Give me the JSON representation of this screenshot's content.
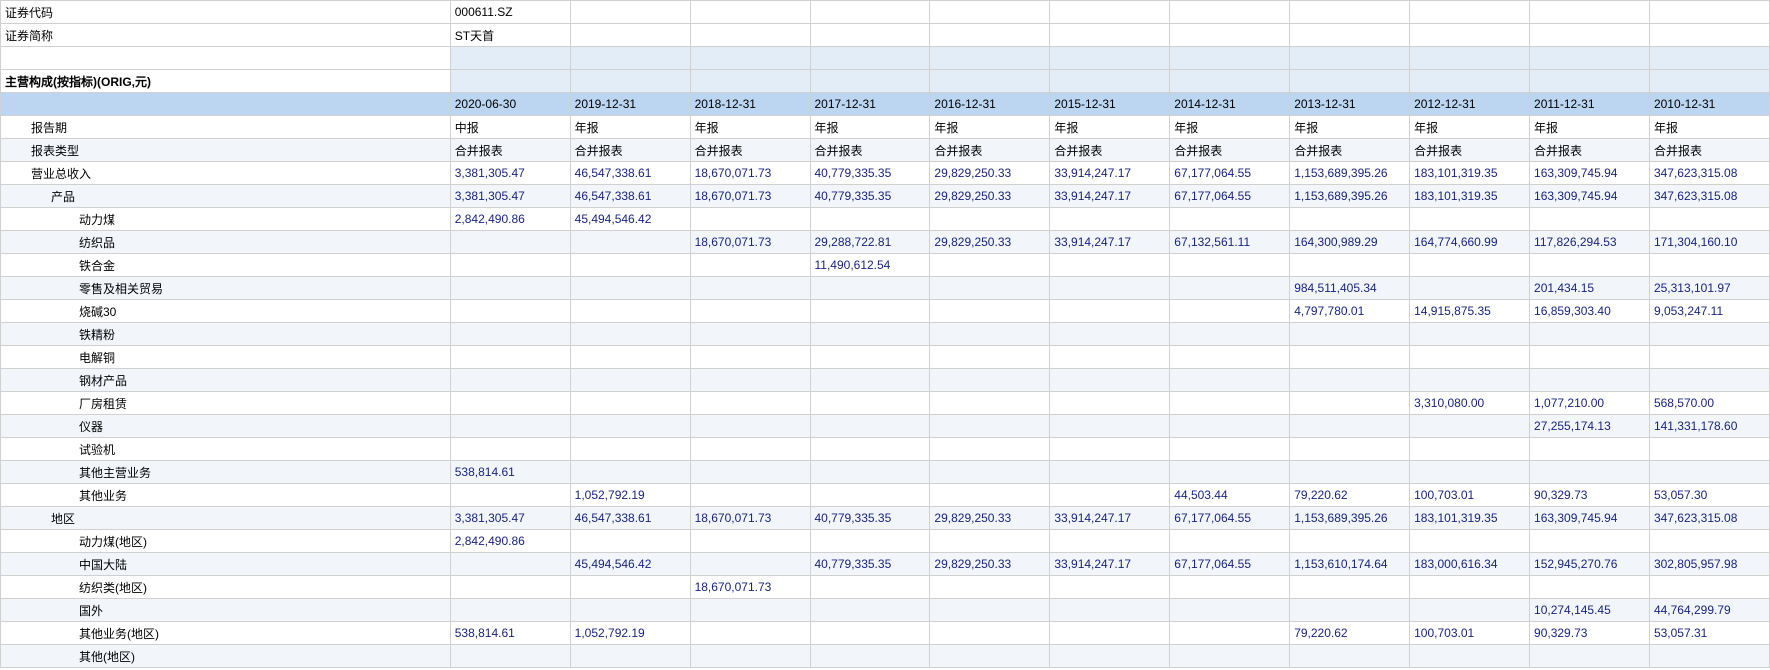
{
  "header": {
    "code_lbl": "证券代码",
    "code_val": "000611.SZ",
    "name_lbl": "证券简称",
    "name_val": "ST天首"
  },
  "section_title": "主营构成(按指标)(ORIG,元)",
  "dates": [
    "2020-06-30",
    "2019-12-31",
    "2018-12-31",
    "2017-12-31",
    "2016-12-31",
    "2015-12-31",
    "2014-12-31",
    "2013-12-31",
    "2012-12-31",
    "2011-12-31",
    "2010-12-31"
  ],
  "rows": [
    {
      "lbl": "报告期",
      "ind": 1,
      "cls": "empty",
      "vals": [
        "中报",
        "年报",
        "年报",
        "年报",
        "年报",
        "年报",
        "年报",
        "年报",
        "年报",
        "年报",
        "年报"
      ],
      "num": false
    },
    {
      "lbl": "报表类型",
      "ind": 1,
      "cls": "alt",
      "vals": [
        "合并报表",
        "合并报表",
        "合并报表",
        "合并报表",
        "合并报表",
        "合并报表",
        "合并报表",
        "合并报表",
        "合并报表",
        "合并报表",
        "合并报表"
      ],
      "num": false
    },
    {
      "lbl": "营业总收入",
      "ind": 1,
      "cls": "empty",
      "vals": [
        "3,381,305.47",
        "46,547,338.61",
        "18,670,071.73",
        "40,779,335.35",
        "29,829,250.33",
        "33,914,247.17",
        "67,177,064.55",
        "1,153,689,395.26",
        "183,101,319.35",
        "163,309,745.94",
        "347,623,315.08"
      ],
      "num": true
    },
    {
      "lbl": "产品",
      "ind": 2,
      "cls": "alt",
      "vals": [
        "3,381,305.47",
        "46,547,338.61",
        "18,670,071.73",
        "40,779,335.35",
        "29,829,250.33",
        "33,914,247.17",
        "67,177,064.55",
        "1,153,689,395.26",
        "183,101,319.35",
        "163,309,745.94",
        "347,623,315.08"
      ],
      "num": true
    },
    {
      "lbl": "动力煤",
      "ind": 3,
      "cls": "empty",
      "vals": [
        "2,842,490.86",
        "45,494,546.42",
        "",
        "",
        "",
        "",
        "",
        "",
        "",
        "",
        ""
      ],
      "num": true
    },
    {
      "lbl": "纺织品",
      "ind": 3,
      "cls": "alt",
      "vals": [
        "",
        "",
        "18,670,071.73",
        "29,288,722.81",
        "29,829,250.33",
        "33,914,247.17",
        "67,132,561.11",
        "164,300,989.29",
        "164,774,660.99",
        "117,826,294.53",
        "171,304,160.10"
      ],
      "num": true
    },
    {
      "lbl": "铁合金",
      "ind": 3,
      "cls": "empty",
      "vals": [
        "",
        "",
        "",
        "11,490,612.54",
        "",
        "",
        "",
        "",
        "",
        "",
        ""
      ],
      "num": true
    },
    {
      "lbl": "零售及相关贸易",
      "ind": 3,
      "cls": "alt",
      "vals": [
        "",
        "",
        "",
        "",
        "",
        "",
        "",
        "984,511,405.34",
        "",
        "201,434.15",
        "25,313,101.97"
      ],
      "num": true
    },
    {
      "lbl": "烧碱30",
      "ind": 3,
      "cls": "empty",
      "vals": [
        "",
        "",
        "",
        "",
        "",
        "",
        "",
        "4,797,780.01",
        "14,915,875.35",
        "16,859,303.40",
        "9,053,247.11"
      ],
      "num": true
    },
    {
      "lbl": "铁精粉",
      "ind": 3,
      "cls": "alt",
      "vals": [
        "",
        "",
        "",
        "",
        "",
        "",
        "",
        "",
        "",
        "",
        ""
      ],
      "num": true
    },
    {
      "lbl": "电解铜",
      "ind": 3,
      "cls": "empty",
      "vals": [
        "",
        "",
        "",
        "",
        "",
        "",
        "",
        "",
        "",
        "",
        ""
      ],
      "num": true
    },
    {
      "lbl": "钢材产品",
      "ind": 3,
      "cls": "alt",
      "vals": [
        "",
        "",
        "",
        "",
        "",
        "",
        "",
        "",
        "",
        "",
        ""
      ],
      "num": true
    },
    {
      "lbl": "厂房租赁",
      "ind": 3,
      "cls": "empty",
      "vals": [
        "",
        "",
        "",
        "",
        "",
        "",
        "",
        "",
        "3,310,080.00",
        "1,077,210.00",
        "568,570.00"
      ],
      "num": true
    },
    {
      "lbl": "仪器",
      "ind": 3,
      "cls": "alt",
      "vals": [
        "",
        "",
        "",
        "",
        "",
        "",
        "",
        "",
        "",
        "27,255,174.13",
        "141,331,178.60"
      ],
      "num": true
    },
    {
      "lbl": "试验机",
      "ind": 3,
      "cls": "empty",
      "vals": [
        "",
        "",
        "",
        "",
        "",
        "",
        "",
        "",
        "",
        "",
        ""
      ],
      "num": true
    },
    {
      "lbl": "其他主营业务",
      "ind": 3,
      "cls": "alt",
      "vals": [
        "538,814.61",
        "",
        "",
        "",
        "",
        "",
        "",
        "",
        "",
        "",
        ""
      ],
      "num": true
    },
    {
      "lbl": "其他业务",
      "ind": 3,
      "cls": "empty",
      "vals": [
        "",
        "1,052,792.19",
        "",
        "",
        "",
        "",
        "44,503.44",
        "79,220.62",
        "100,703.01",
        "90,329.73",
        "53,057.30"
      ],
      "num": true
    },
    {
      "lbl": "地区",
      "ind": 2,
      "cls": "alt",
      "vals": [
        "3,381,305.47",
        "46,547,338.61",
        "18,670,071.73",
        "40,779,335.35",
        "29,829,250.33",
        "33,914,247.17",
        "67,177,064.55",
        "1,153,689,395.26",
        "183,101,319.35",
        "163,309,745.94",
        "347,623,315.08"
      ],
      "num": true
    },
    {
      "lbl": "动力煤(地区)",
      "ind": 3,
      "cls": "empty",
      "vals": [
        "2,842,490.86",
        "",
        "",
        "",
        "",
        "",
        "",
        "",
        "",
        "",
        ""
      ],
      "num": true
    },
    {
      "lbl": "中国大陆",
      "ind": 3,
      "cls": "alt",
      "vals": [
        "",
        "45,494,546.42",
        "",
        "40,779,335.35",
        "29,829,250.33",
        "33,914,247.17",
        "67,177,064.55",
        "1,153,610,174.64",
        "183,000,616.34",
        "152,945,270.76",
        "302,805,957.98"
      ],
      "num": true
    },
    {
      "lbl": "纺织类(地区)",
      "ind": 3,
      "cls": "empty",
      "vals": [
        "",
        "",
        "18,670,071.73",
        "",
        "",
        "",
        "",
        "",
        "",
        "",
        ""
      ],
      "num": true
    },
    {
      "lbl": "国外",
      "ind": 3,
      "cls": "alt",
      "vals": [
        "",
        "",
        "",
        "",
        "",
        "",
        "",
        "",
        "",
        "10,274,145.45",
        "44,764,299.79"
      ],
      "num": true
    },
    {
      "lbl": "其他业务(地区)",
      "ind": 3,
      "cls": "empty",
      "vals": [
        "538,814.61",
        "1,052,792.19",
        "",
        "",
        "",
        "",
        "",
        "79,220.62",
        "100,703.01",
        "90,329.73",
        "53,057.31"
      ],
      "num": true
    },
    {
      "lbl": "其他(地区)",
      "ind": 3,
      "cls": "alt",
      "vals": [
        "",
        "",
        "",
        "",
        "",
        "",
        "",
        "",
        "",
        "",
        ""
      ],
      "num": true
    }
  ]
}
